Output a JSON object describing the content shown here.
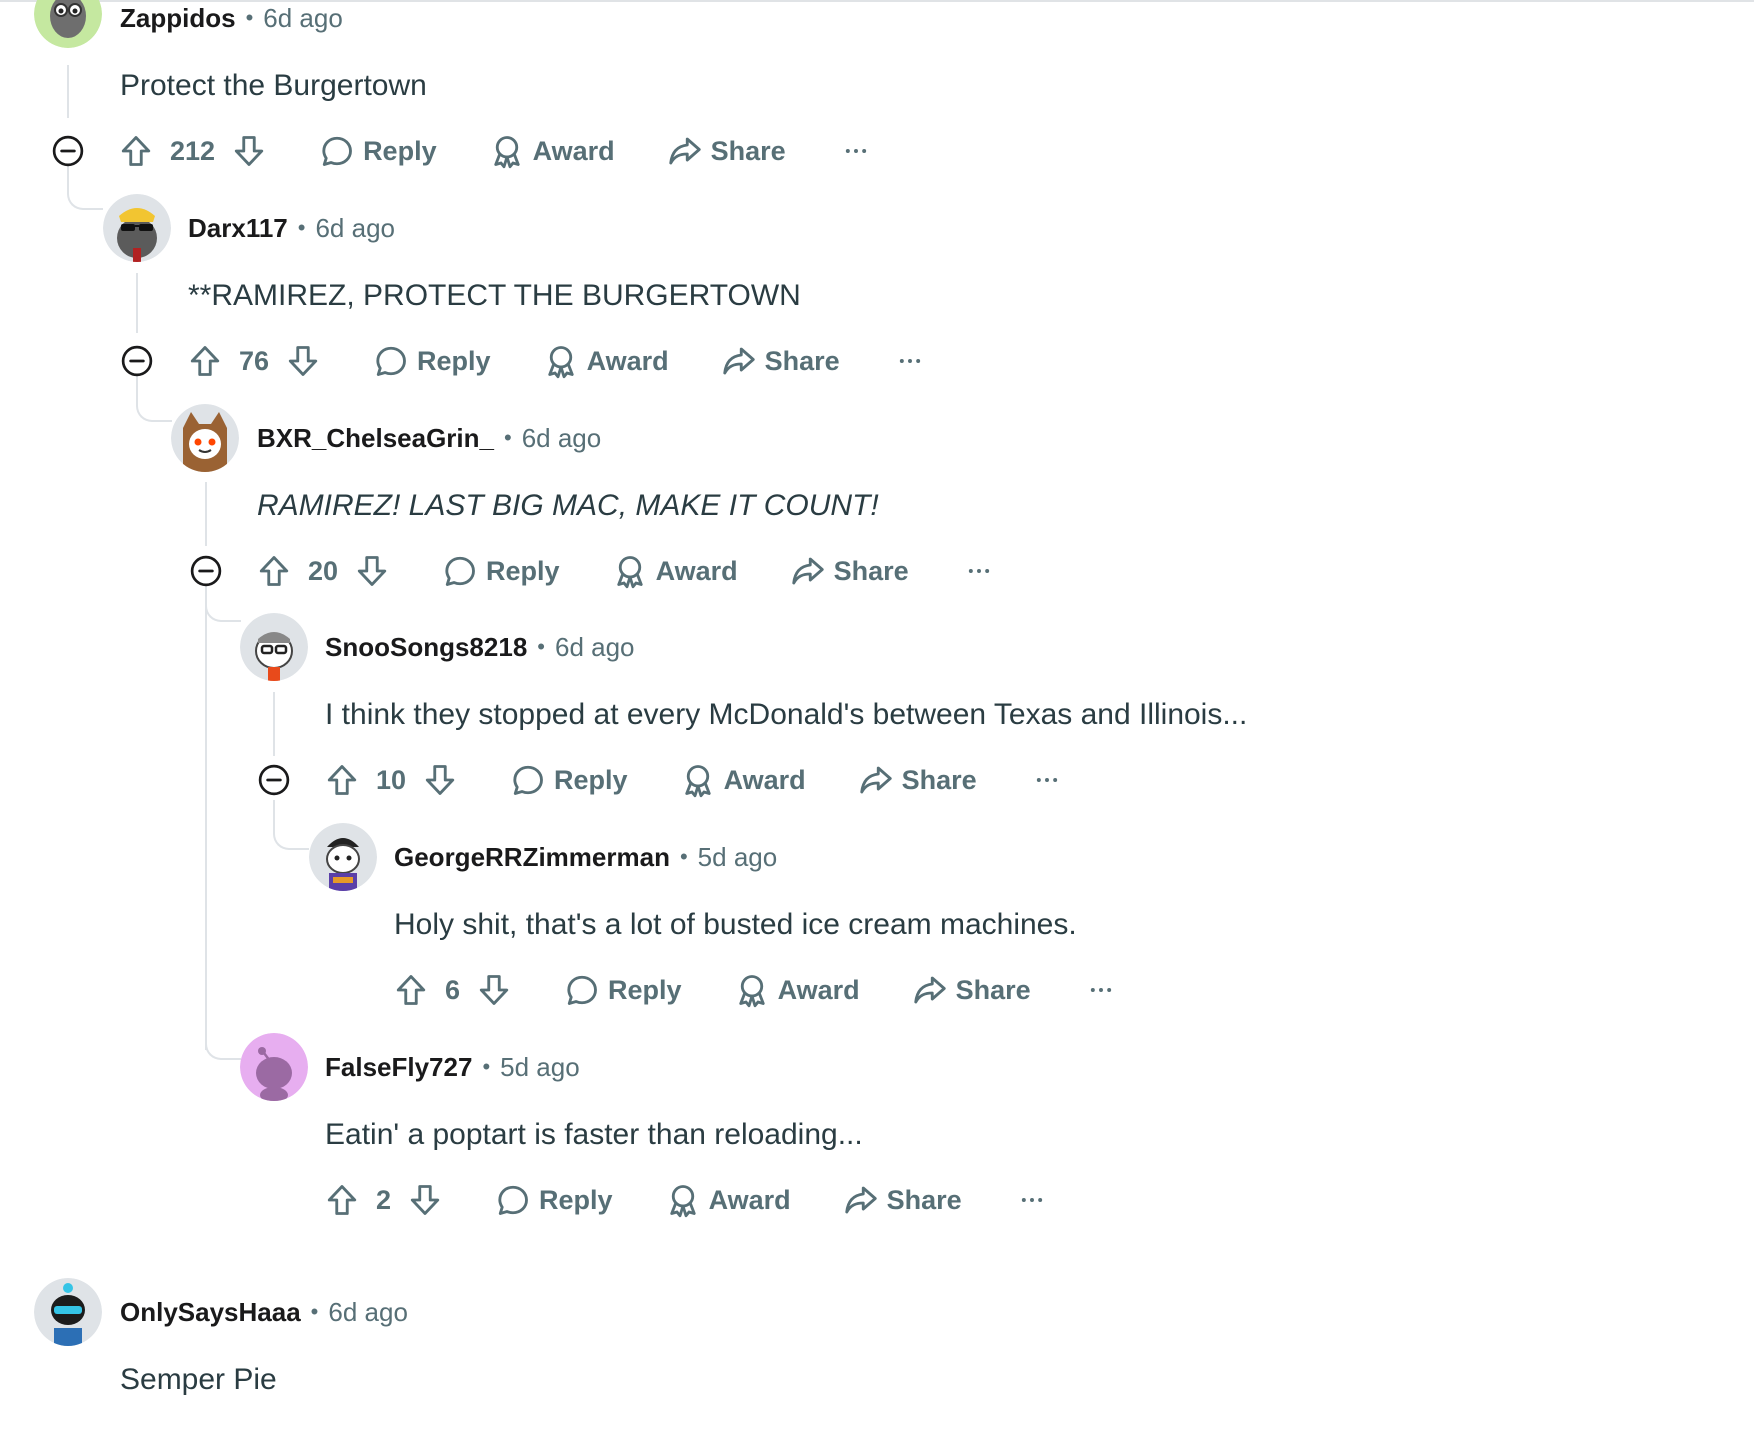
{
  "actions": {
    "reply": "Reply",
    "award": "Award",
    "share": "Share"
  },
  "comments": [
    {
      "author": "Zappidos",
      "separator": "•",
      "time": "6d ago",
      "body": "Protect the Burgertown",
      "score": "212",
      "avatar_color": "#c5e8a0"
    },
    {
      "author": "Darx117",
      "separator": "•",
      "time": "6d ago",
      "body": "**RAMIREZ, PROTECT THE BURGERTOWN",
      "score": "76",
      "avatar_color": "#dfe3e7"
    },
    {
      "author": "BXR_ChelseaGrin_",
      "separator": "•",
      "time": "6d ago",
      "body": "RAMIREZ! LAST BIG MAC, MAKE IT COUNT!",
      "score": "20",
      "avatar_color": "#dfe3e7"
    },
    {
      "author": "SnooSongs8218",
      "separator": "•",
      "time": "6d ago",
      "body": "I think they stopped at every McDonald's between Texas and Illinois...",
      "score": "10",
      "avatar_color": "#dfe3e7"
    },
    {
      "author": "GeorgeRRZimmerman",
      "separator": "•",
      "time": "5d ago",
      "body": "Holy shit, that's a lot of busted ice cream machines.",
      "score": "6",
      "avatar_color": "#dfe3e7"
    },
    {
      "author": "FalseFly727",
      "separator": "•",
      "time": "5d ago",
      "body": "Eatin' a poptart is faster than reloading...",
      "score": "2",
      "avatar_color": "#e7aef0"
    },
    {
      "author": "OnlySaysHaaa",
      "separator": "•",
      "time": "6d ago",
      "body": "Semper Pie",
      "avatar_color": "#dfe3e7"
    }
  ],
  "colors": {
    "meta": "#576f76",
    "thread_line": "#dfe3e7",
    "text": "#2a3c42"
  }
}
